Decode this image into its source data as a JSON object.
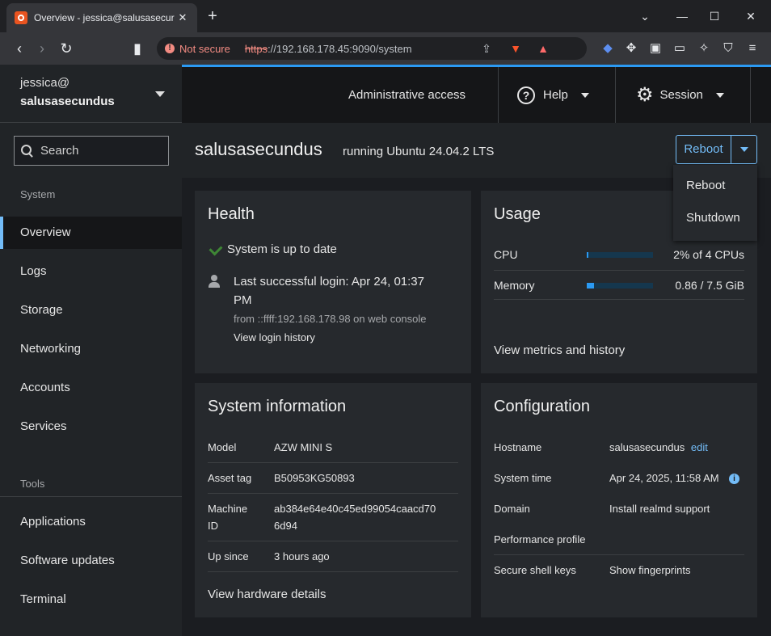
{
  "browser": {
    "tab_title": "Overview - jessica@salusasecur",
    "not_secure": "Not secure",
    "url_scheme": "https",
    "url_rest": "://192.168.178.45:9090/system"
  },
  "sidebar": {
    "user": "jessica@",
    "host": "salusasecundus",
    "search_placeholder": "Search",
    "section_system": "System",
    "section_tools": "Tools",
    "items": [
      {
        "label": "Overview"
      },
      {
        "label": "Logs"
      },
      {
        "label": "Storage"
      },
      {
        "label": "Networking"
      },
      {
        "label": "Accounts"
      },
      {
        "label": "Services"
      }
    ],
    "tools": [
      {
        "label": "Applications"
      },
      {
        "label": "Software updates"
      },
      {
        "label": "Terminal"
      }
    ]
  },
  "topbar": {
    "admin": "Administrative access",
    "help": "Help",
    "session": "Session"
  },
  "header": {
    "hostname": "salusasecundus",
    "os": "running Ubuntu 24.04.2 LTS",
    "reboot": "Reboot",
    "menu": [
      "Reboot",
      "Shutdown"
    ]
  },
  "health": {
    "title": "Health",
    "status": "System is up to date",
    "login_line1": "Last successful login: Apr 24, 01:37",
    "login_line2": "PM",
    "login_from": "from ::ffff:192.168.178.98 on web console",
    "history_link": "View login history"
  },
  "usage": {
    "title": "Usage",
    "cpu_label": "CPU",
    "cpu_value": "2% of 4 CPUs",
    "cpu_fraction": 0.02,
    "mem_label": "Memory",
    "mem_value": "0.86 / 7.5 GiB",
    "mem_fraction": 0.115,
    "metrics_link": "View metrics and history"
  },
  "sysinfo": {
    "title": "System information",
    "model_label": "Model",
    "model": "AZW MINI S",
    "asset_label": "Asset tag",
    "asset": "B50953KG50893",
    "machine_label1": "Machine",
    "machine_label2": "ID",
    "machine_id1": "ab384e64e40c45ed99054caacd70",
    "machine_id2": "6d94",
    "up_label": "Up since",
    "up": "3 hours ago",
    "hw_link": "View hardware details"
  },
  "config": {
    "title": "Configuration",
    "hostname_label": "Hostname",
    "hostname": "salusasecundus",
    "edit": "edit",
    "time_label": "System time",
    "time": "Apr 24, 2025, 11:58 AM",
    "domain_label": "Domain",
    "domain": "Install realmd support",
    "perf_label": "Performance profile",
    "ssh_label": "Secure shell keys",
    "ssh": "Show fingerprints"
  },
  "colors": {
    "accent": "#73bcf7",
    "bar": "#2b9af3",
    "ok": "#3e8635",
    "warn": "#f28b82"
  }
}
